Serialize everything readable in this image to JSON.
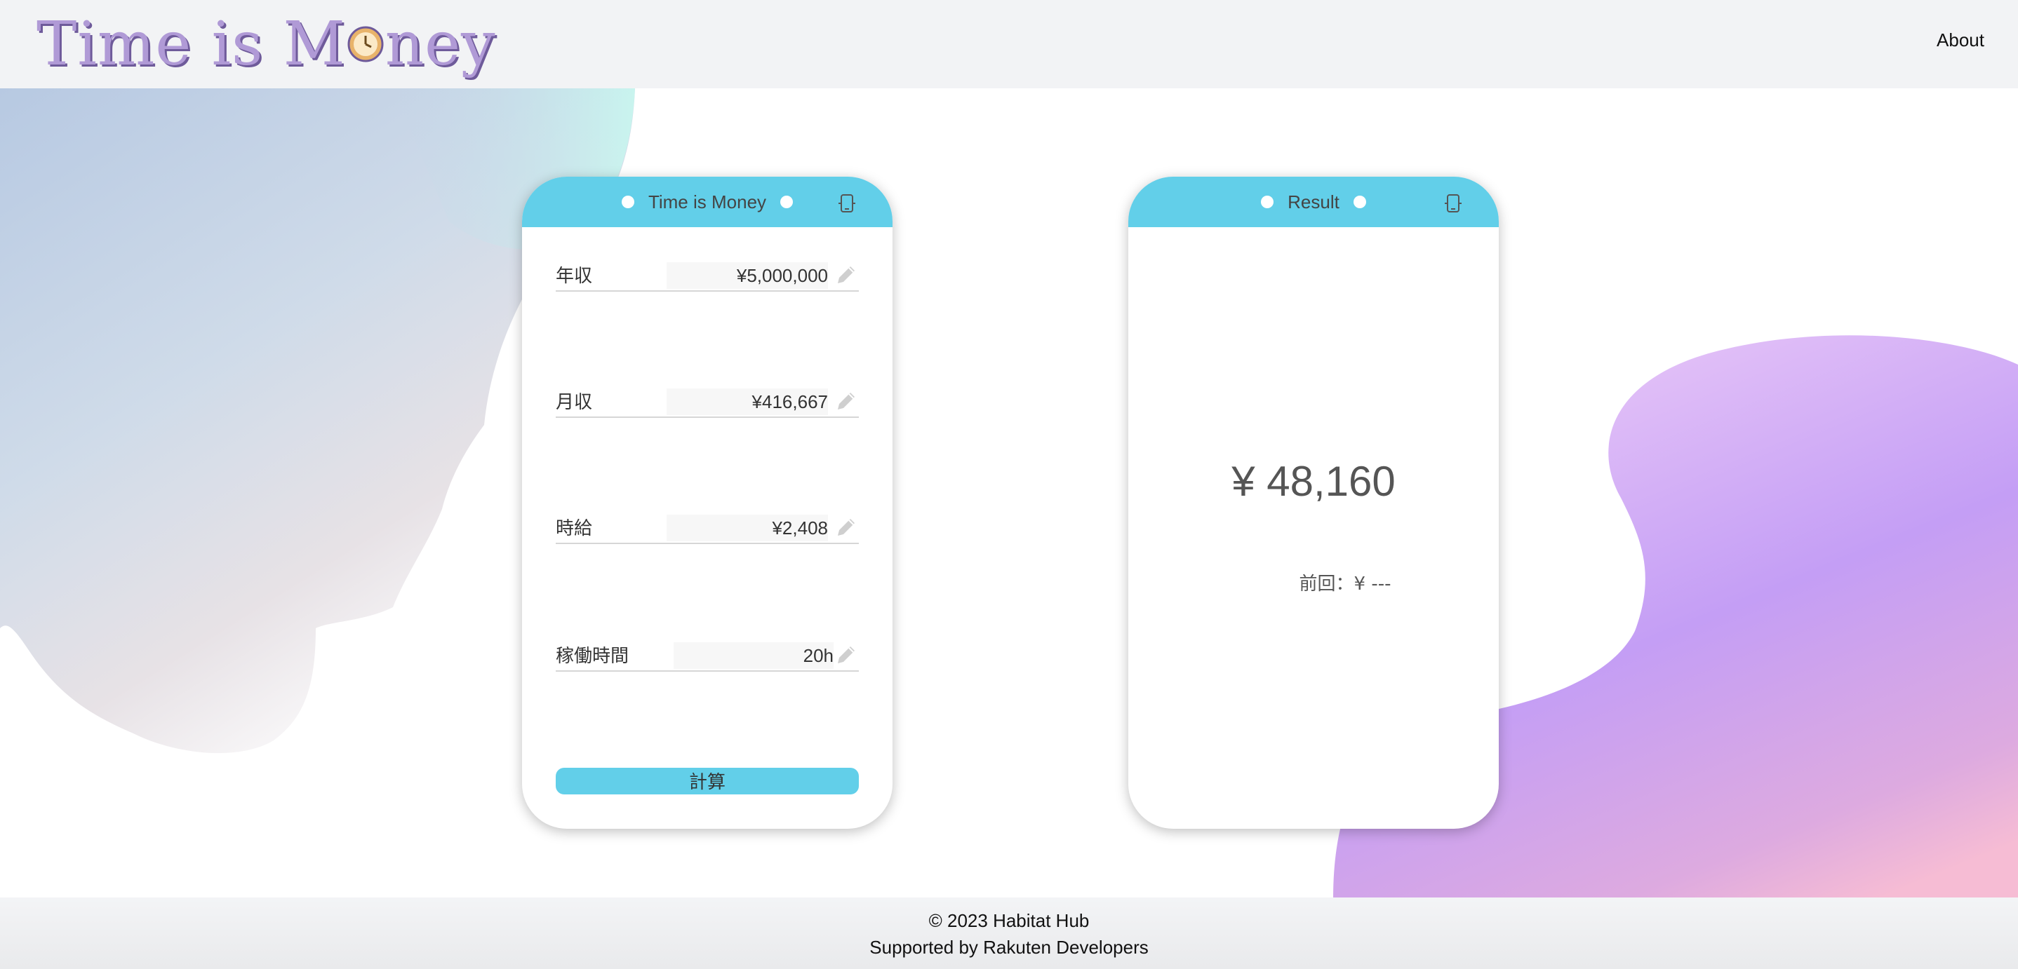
{
  "header": {
    "logo_part1": "Time is M",
    "logo_part2": "ney",
    "about": "About"
  },
  "calculator": {
    "title": "Time is Money",
    "fields": [
      {
        "label": "年収",
        "value": "¥5,000,000"
      },
      {
        "label": "月収",
        "value": "¥416,667"
      },
      {
        "label": "時給",
        "value": "¥2,408"
      },
      {
        "label": "稼働時間",
        "value": "20h"
      }
    ],
    "button": "計算"
  },
  "result": {
    "title": "Result",
    "amount": "¥ 48,160",
    "previous": "前回：¥ ---"
  },
  "footer": {
    "copyright": "© 2023 Habitat Hub",
    "supported": "Supported by Rakuten Developers"
  },
  "colors": {
    "accent": "#62cfe9",
    "logo": "#b09ad6",
    "blob_purple": "#c19ef6",
    "blob_blue": "#b9cbe3"
  },
  "icons": [
    "clock-icon",
    "phone-icon",
    "pencil-icon"
  ]
}
